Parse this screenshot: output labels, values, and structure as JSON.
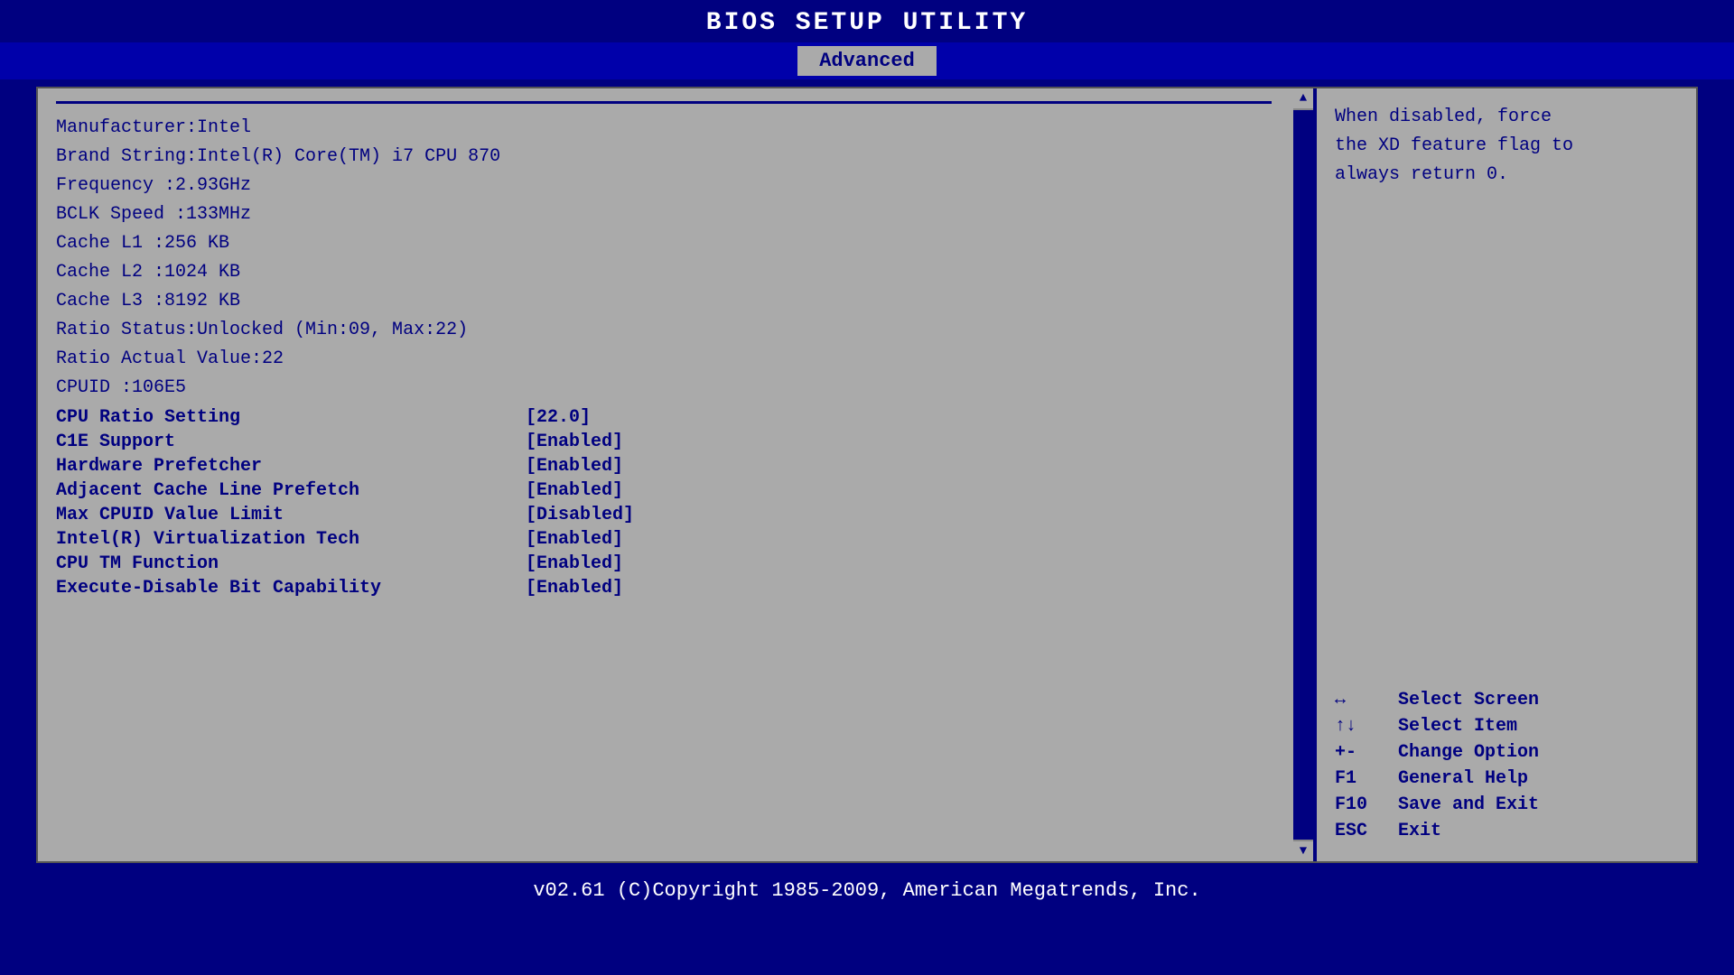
{
  "title": "BIOS SETUP UTILITY",
  "tab": "Advanced",
  "help_text": {
    "line1": "When disabled, force",
    "line2": "the XD feature flag to",
    "line3": "always return 0."
  },
  "cpu_info": [
    {
      "label": "Manufacturer",
      "value": "Intel"
    },
    {
      "label": "Brand String",
      "value": "Intel(R) Core(TM) i7 CPU        870"
    },
    {
      "label": "Frequency",
      "value": "2.93GHz"
    },
    {
      "label": "BCLK Speed",
      "value": "133MHz"
    },
    {
      "label": "Cache L1",
      "value": "256 KB"
    },
    {
      "label": "Cache L2",
      "value": "1024 KB"
    },
    {
      "label": "Cache L3",
      "value": "8192 KB"
    },
    {
      "label": "Ratio Status",
      "value": "Unlocked (Min:09, Max:22)"
    },
    {
      "label": "Ratio Actual Value",
      "value": "22"
    },
    {
      "label": "CPUID",
      "value": "106E5"
    }
  ],
  "settings": [
    {
      "label": "CPU Ratio Setting",
      "value": "[22.0]"
    },
    {
      "label": "C1E Support",
      "value": "[Enabled]"
    },
    {
      "label": "Hardware Prefetcher",
      "value": "[Enabled]"
    },
    {
      "label": "Adjacent Cache Line Prefetch",
      "value": "[Enabled]"
    },
    {
      "label": "Max CPUID Value Limit",
      "value": "[Disabled]"
    },
    {
      "label": "Intel(R) Virtualization Tech",
      "value": "[Enabled]"
    },
    {
      "label": "CPU TM Function",
      "value": "[Enabled]"
    },
    {
      "label": "Execute-Disable Bit Capability",
      "value": "[Enabled]"
    }
  ],
  "key_help": [
    {
      "symbol": "↔",
      "desc": "Select Screen"
    },
    {
      "symbol": "↑↓",
      "desc": "Select Item"
    },
    {
      "symbol": "+-",
      "desc": "Change Option"
    },
    {
      "symbol": "F1",
      "desc": "General Help"
    },
    {
      "symbol": "F10",
      "desc": "Save and Exit"
    },
    {
      "symbol": "ESC",
      "desc": "Exit"
    }
  ],
  "footer": "v02.61 (C)Copyright 1985-2009, American Megatrends, Inc."
}
